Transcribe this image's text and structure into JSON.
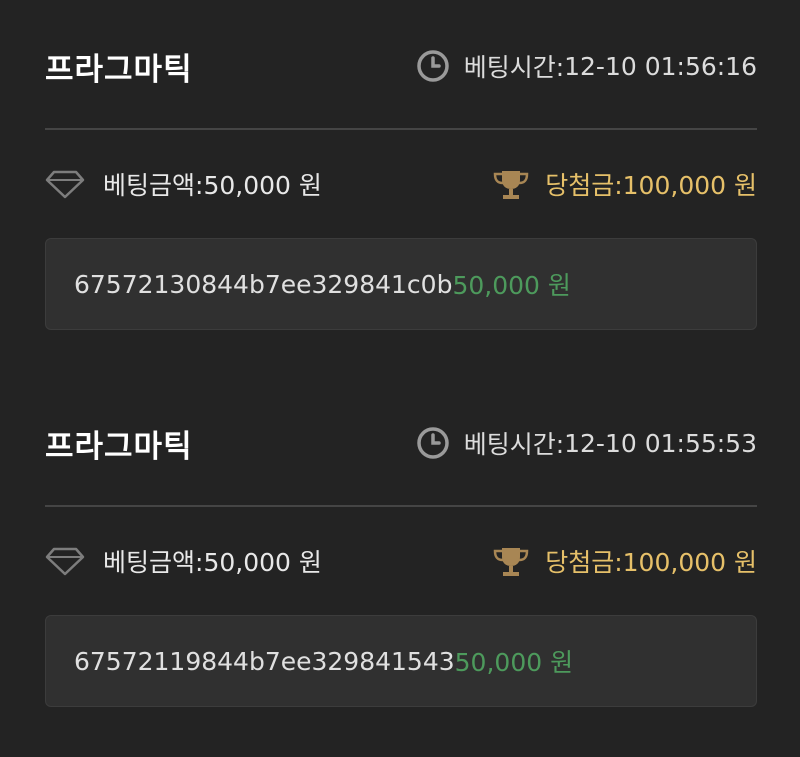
{
  "bets": [
    {
      "provider": "프라그마틱",
      "time_label": "베팅시간:",
      "time_value": "12-10 01:56:16",
      "bet_label": "베팅금액:",
      "bet_amount": "50,000 원",
      "win_label": "당첨금:",
      "win_amount": "100,000 원",
      "round_id": "67572130844b7ee329841c0b",
      "round_amount": "50,000 원"
    },
    {
      "provider": "프라그마틱",
      "time_label": "베팅시간:",
      "time_value": "12-10 01:55:53",
      "bet_label": "베팅금액:",
      "bet_amount": "50,000 원",
      "win_label": "당첨금:",
      "win_amount": "100,000 원",
      "round_id": "67572119844b7ee329841543",
      "round_amount": "50,000 원"
    }
  ],
  "icons": {
    "time": "clock-icon",
    "bet": "diamond-icon",
    "win": "trophy-icon"
  },
  "colors": {
    "background": "#232323",
    "box": "#303030",
    "win_gold": "#e6c069",
    "amount_green": "#4d9a5c"
  }
}
